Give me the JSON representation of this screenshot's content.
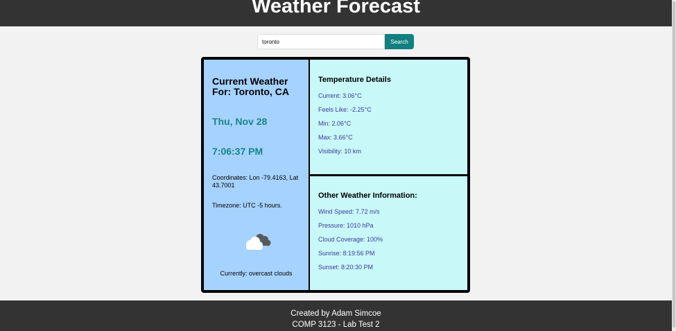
{
  "header": {
    "title": "Weather Forecast"
  },
  "search": {
    "value": "toronto",
    "button_label": "Search"
  },
  "current": {
    "heading": "Current Weather For: Toronto, CA",
    "date": "Thu, Nov 28",
    "time": "7:06:37 PM",
    "coordinates": "Coordinates: Lon -79.4163, Lat 43.7001",
    "timezone": "Timezone: UTC -5 hours.",
    "icon": "overcast-clouds-icon",
    "description": "Currently: overcast clouds"
  },
  "temperature": {
    "title": "Temperature Details",
    "items": [
      "Current: 3.06°C",
      "Feels Like: -2.25°C",
      "Min: 2.06°C",
      "Max: 3.66°C",
      "Visibility: 10 km"
    ]
  },
  "other": {
    "title": "Other Weather Information:",
    "items": [
      "Wind Speed: 7.72 m/s",
      "Pressure: 1010 hPa",
      "Cloud Coverage: 100%",
      "Sunrise: 8:19:56 PM",
      "Sunset: 8:20:30 PM"
    ]
  },
  "footer": {
    "credit": "Created by Adam Simcoe",
    "course": "COMP 3123 - Lab Test 2"
  },
  "colors": {
    "header_bg": "#333333",
    "button_bg": "#128080",
    "left_panel_bg": "#a6d2ff",
    "right_panel_bg": "#c8f8f8",
    "accent_text": "#168686",
    "detail_text": "#3b3b9b"
  }
}
